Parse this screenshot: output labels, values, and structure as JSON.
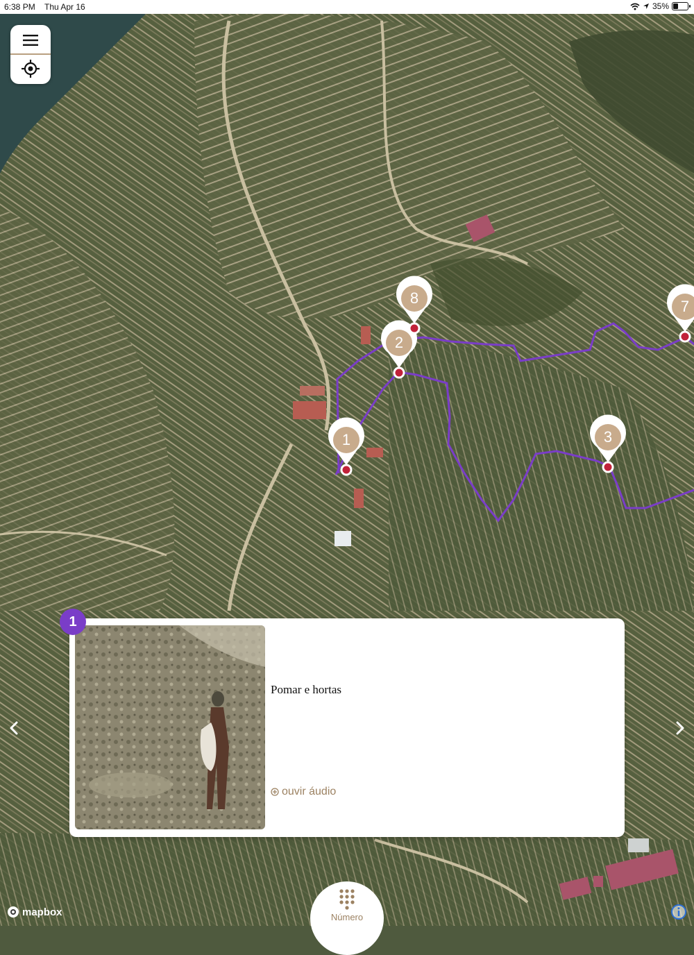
{
  "status_bar": {
    "time": "6:38 PM",
    "date": "Thu Apr 16",
    "battery": "35%",
    "battery_level": 0.35
  },
  "map": {
    "markers": [
      {
        "number": "1"
      },
      {
        "number": "2"
      },
      {
        "number": "3"
      },
      {
        "number": "7"
      },
      {
        "number": "8"
      }
    ],
    "route_color": "#7a3dc8",
    "marker_color": "#c8ab8c",
    "pin_dot_color": "#c1223a"
  },
  "controls": {
    "menu_icon": "hamburger-icon",
    "locate_icon": "locate-icon"
  },
  "card": {
    "badge": "1",
    "title": "Pomar e hortas",
    "audio_label": "ouvir áudio"
  },
  "nav": {
    "prev_icon": "chevron-left-icon",
    "next_icon": "chevron-right-icon"
  },
  "bottom_tab": {
    "label": "Número",
    "icon": "keypad-icon"
  },
  "attribution": {
    "logo_text": "mapbox"
  },
  "colors": {
    "accent": "#9c8262",
    "badge": "#7a3dc8"
  }
}
